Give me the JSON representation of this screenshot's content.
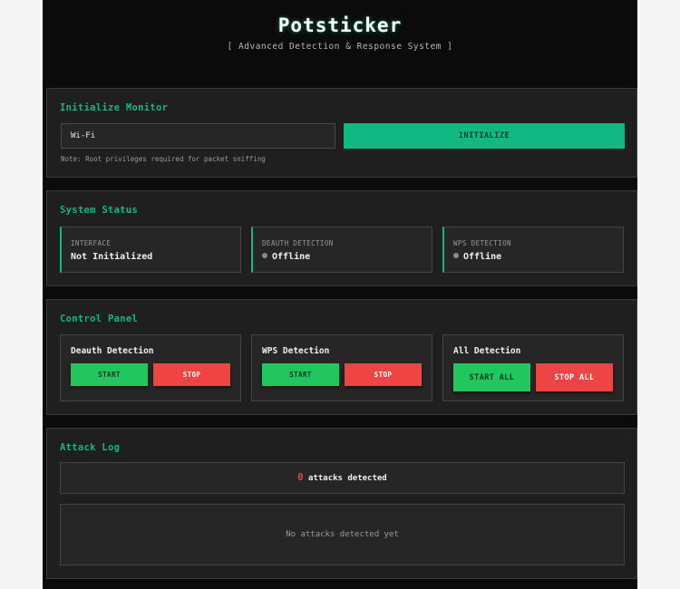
{
  "header": {
    "title": "Potsticker",
    "subtitle": "[ Advanced Detection & Response System ]"
  },
  "init": {
    "title": "Initialize Monitor",
    "interface_value": "Wi-Fi",
    "button_label": "INITIALIZE",
    "note": "Note: Root privileges required for packet sniffing"
  },
  "status": {
    "title": "System Status",
    "cards": [
      {
        "label": "INTERFACE",
        "value": "Not Initialized"
      },
      {
        "label": "DEAUTH DETECTION",
        "value": "Offline"
      },
      {
        "label": "WPS DETECTION",
        "value": "Offline"
      }
    ]
  },
  "control": {
    "title": "Control Panel",
    "groups": [
      {
        "label": "Deauth Detection",
        "start": "START",
        "stop": "STOP"
      },
      {
        "label": "WPS Detection",
        "start": "START",
        "stop": "STOP"
      },
      {
        "label": "All Detection",
        "start": "START ALL",
        "stop": "STOP ALL"
      }
    ]
  },
  "log": {
    "title": "Attack Log",
    "count": "0",
    "count_suffix": "attacks detected",
    "empty_message": "No attacks detected yet"
  },
  "colors": {
    "accent": "#10b981",
    "start": "#22c55e",
    "stop": "#ef4444",
    "background": "#0b0b0b",
    "panel": "#1f1f1f"
  }
}
